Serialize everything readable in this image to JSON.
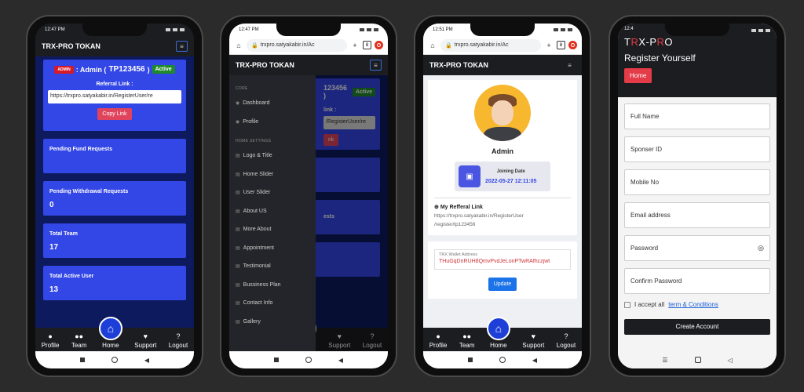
{
  "brand": "TRX-PRO TOKAN",
  "phone1": {
    "time": "12:47 PM",
    "admin_badge": "ADMIN",
    "admin_label": ": Admin (",
    "admin_id": "TP123456",
    "admin_close": ")",
    "active": "Active",
    "referral_label": "Referral Link :",
    "referral_url": "https://trxpro.satyakabir.in/RegisterUser/re",
    "copy_btn": "Copy Link",
    "cards": [
      {
        "label": "Pending Fund Requests",
        "value": ""
      },
      {
        "label": "Pending Withdrawal Requests",
        "value": "0"
      },
      {
        "label": "Total Team",
        "value": "17"
      },
      {
        "label": "Total Active User",
        "value": "13"
      }
    ]
  },
  "bottom_nav": {
    "profile": "Profile",
    "team": "Team",
    "home": "Home",
    "support": "Support",
    "logout": "Logout"
  },
  "phone2": {
    "time": "12:47 PM",
    "url": "trxpro.satyakabir.in/Ac",
    "tab_count": "8",
    "core_label": "CORE",
    "core_items": [
      "Dashboard",
      "Profile"
    ],
    "settings_label": "HOME SETTINGS",
    "settings_items": [
      "Logo & Title",
      "Home Slider",
      "User Slider",
      "About US",
      "More About",
      "Appointment",
      "Testimonial",
      "Bussiness Plan",
      "Contact Info",
      "Gallery"
    ],
    "bg_admin_id": "123456 )",
    "bg_active": "Active",
    "bg_link": "link :",
    "bg_url": "/RegisterUser/re",
    "bg_copy": "nk",
    "bg_requests": "ests"
  },
  "phone3": {
    "time": "12:51 PM",
    "url": "trxpro.satyakabir.in/Ac",
    "tab_count": "8",
    "name": "Admin",
    "joining_label": "Joining Date",
    "joining_value": "2022-05-27 12:11:05",
    "ref_title": "My Refferal Link",
    "ref_url_1": "https://trxpro.satyakabir.in/RegisterUser",
    "ref_url_2": "/register/tp123456",
    "wallet_label": "TRX Wallet Address",
    "wallet_value": "THuGqDnRUH8QmvPvdJeLonPTwRAfhczjwt",
    "update_btn": "Update"
  },
  "phone4": {
    "time": "12:4",
    "brand_r": "R",
    "brand_x_pre": "T",
    "brand_mid": "X-P",
    "brand_r2": "R",
    "brand_o": "O",
    "title": "Register Yourself",
    "home_btn": "Home",
    "fields": [
      "Full Name",
      "Sponser ID",
      "Mobile No",
      "Email address",
      "Password",
      "Confirm Password"
    ],
    "terms_prefix": "I accept all",
    "terms_link": "term & Conditions",
    "create_btn": "Create Account"
  }
}
